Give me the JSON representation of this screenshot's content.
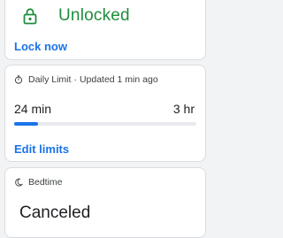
{
  "lock_card": {
    "status": "Unlocked",
    "action_label": "Lock now",
    "icon": "unlocked-padlock-icon",
    "status_color": "#1e8e3e"
  },
  "daily_limit_card": {
    "title": "Daily Limit",
    "separator": "·",
    "updated": "Updated 1 min ago",
    "icon": "timer-icon",
    "usage": "24 min",
    "limit": "3 hr",
    "progress_fraction": 0.133,
    "action_label": "Edit limits"
  },
  "bedtime_card": {
    "title": "Bedtime",
    "icon": "moon-icon",
    "status": "Canceled"
  },
  "colors": {
    "accent": "#1a73e8",
    "success": "#1e8e3e",
    "background": "#f1f3f4"
  }
}
